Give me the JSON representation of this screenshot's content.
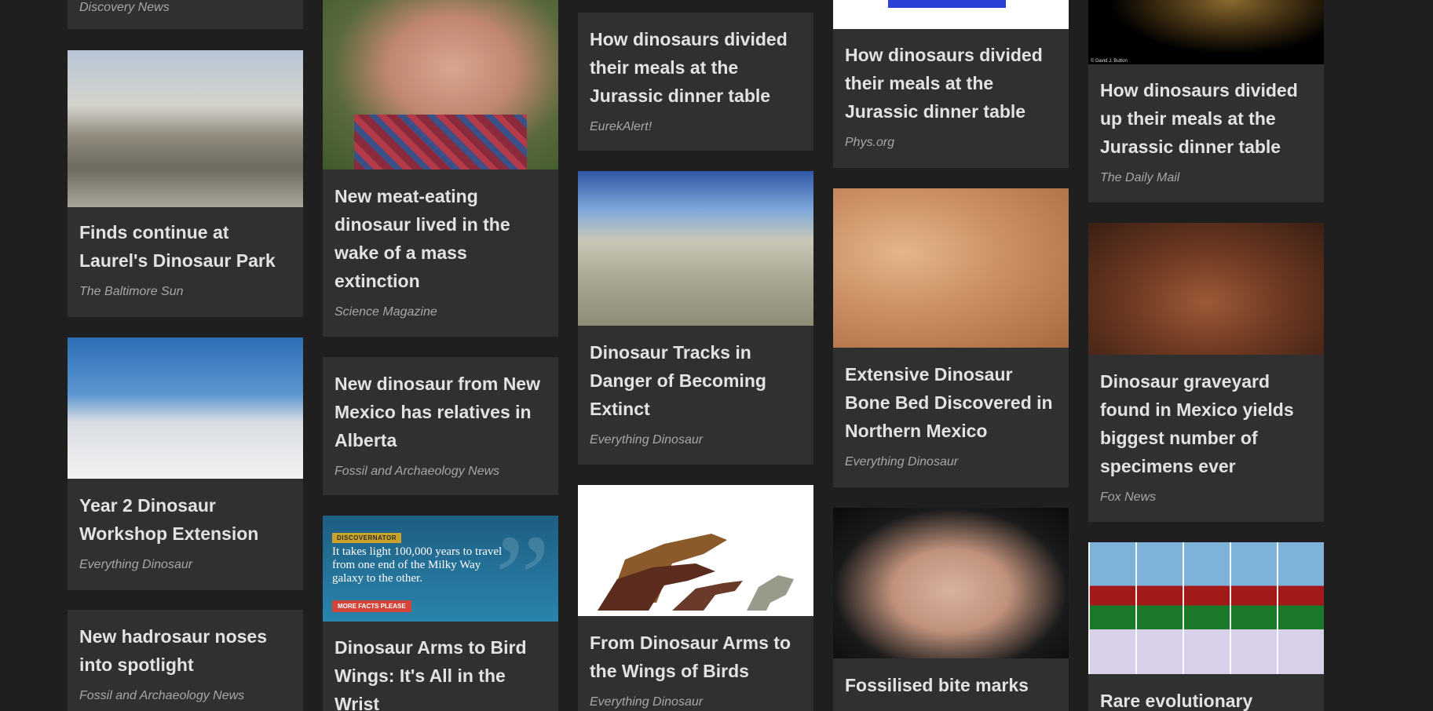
{
  "columns": [
    {
      "cards": [
        {
          "source": "Discovery News"
        },
        {
          "title": "Finds continue at Laurel's Dinosaur Park",
          "source": "The Baltimore Sun"
        },
        {
          "title": "Year 2 Dinosaur Workshop Extension",
          "source": "Everything Dinosaur"
        },
        {
          "title": "New hadrosaur noses into spotlight",
          "source": "Fossil and Archaeology News"
        }
      ]
    },
    {
      "cards": [
        {
          "title": "New meat-eating dinosaur lived in the wake of a mass extinction",
          "source": "Science Magazine"
        },
        {
          "title": "New dinosaur from New Mexico has relatives in Alberta",
          "source": "Fossil and Archaeology News"
        },
        {
          "title": "Dinosaur Arms to Bird Wings: It's All in the Wrist",
          "image": {
            "tag": "DISCOVERNATOR",
            "text": "It takes light 100,000 years to travel from one end of the Milky Way galaxy to the other.",
            "button": "MORE FACTS PLEASE",
            "quote": "”"
          }
        }
      ]
    },
    {
      "cards": [
        {
          "title": "How dinosaurs divided their meals at the Jurassic dinner table",
          "source": "EurekAlert!"
        },
        {
          "title": "Dinosaur Tracks in Danger of Becoming Extinct",
          "source": "Everything Dinosaur"
        },
        {
          "title": "From Dinosaur Arms to the Wings of Birds",
          "source": "Everything Dinosaur"
        }
      ]
    },
    {
      "cards": [
        {
          "title": "How dinosaurs divided their meals at the Jurassic dinner table",
          "source": "Phys.org"
        },
        {
          "title": "Extensive Dinosaur Bone Bed Discovered in Northern Mexico",
          "source": "Everything Dinosaur"
        },
        {
          "title": "Fossilised bite marks"
        }
      ]
    },
    {
      "cards": [
        {
          "title": "How dinosaurs divided up their meals at the Jurassic dinner table",
          "source": "The Daily Mail",
          "image": {
            "credit": "© David J. Button"
          }
        },
        {
          "title": "Dinosaur graveyard found in Mexico yields biggest number of specimens ever",
          "source": "Fox News"
        },
        {
          "title": "Rare evolutionary"
        }
      ]
    }
  ]
}
